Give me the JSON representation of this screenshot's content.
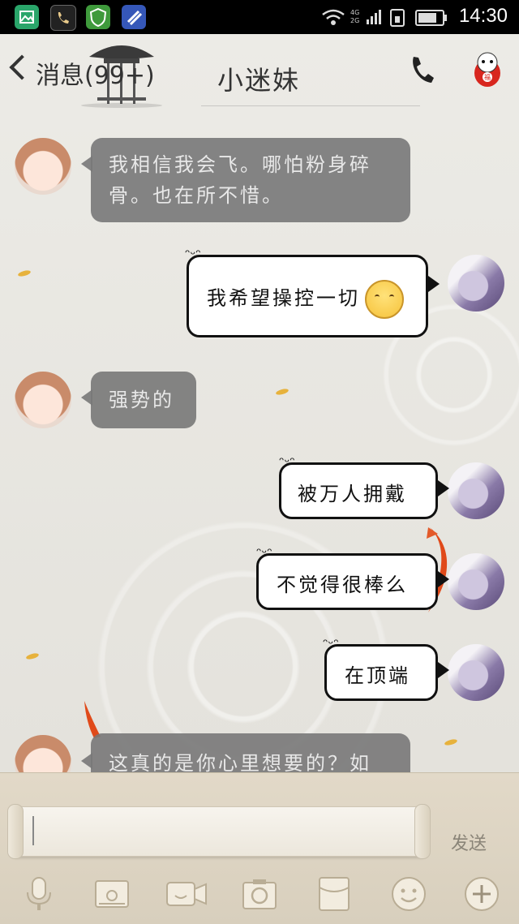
{
  "status_bar": {
    "time": "14:30",
    "network": "4G 2G",
    "apps": [
      {
        "name": "gallery-app-icon",
        "color": "#2aa56a"
      },
      {
        "name": "phone-app-icon",
        "color": "#222222"
      },
      {
        "name": "security-app-icon",
        "color": "#3f9a3c"
      },
      {
        "name": "tools-app-icon",
        "color": "#3557b8"
      }
    ]
  },
  "header": {
    "back_label": "消息(99+)",
    "title": "小迷妹",
    "call_icon": "phone-icon",
    "avatar_icon": "daruma-icon"
  },
  "messages": [
    {
      "side": "left",
      "text": "我相信我会飞。哪怕粉身碎骨。也在所不惜。"
    },
    {
      "side": "right",
      "text": "我希望操控一切",
      "emoji": "shy-face-emoji"
    },
    {
      "side": "left",
      "text": "强势的"
    },
    {
      "side": "right",
      "text": "被万人拥戴"
    },
    {
      "side": "right",
      "text": "不觉得很棒么"
    },
    {
      "side": "right",
      "text": "在顶端"
    },
    {
      "side": "left",
      "text": "这真的是你心里想要的？如"
    }
  ],
  "input": {
    "placeholder": "",
    "send_label": "发送"
  },
  "toolbar": [
    {
      "name": "microphone-icon"
    },
    {
      "name": "image-icon"
    },
    {
      "name": "video-call-icon"
    },
    {
      "name": "camera-icon"
    },
    {
      "name": "red-packet-icon"
    },
    {
      "name": "emoji-icon"
    },
    {
      "name": "plus-icon"
    }
  ],
  "colors": {
    "left_bubble": "#787878",
    "right_bubble_border": "#111111",
    "background": "#e9e7e2",
    "input_panel": "#ddd4c2"
  }
}
